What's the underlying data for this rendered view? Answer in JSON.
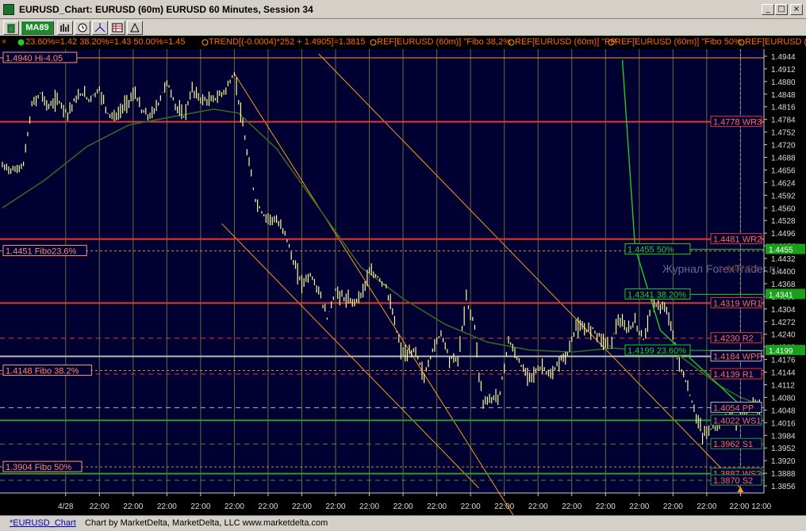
{
  "window": {
    "title": "EURUSD_Chart: EURUSD (60m) EURUSD 60 Minutes, Session 34",
    "minimize_label": "_",
    "maximize_label": "□",
    "close_label": "×"
  },
  "toolbar": {
    "ma_label": "MA89"
  },
  "indicator_bar": [
    "23.60%=1.42 38.20%=1.43 50.00%=1.45",
    "TREND[(-0.0004)*252 + 1.4905]=1.3815",
    "REF[EURUSD (60m)] \"Fibo 38,2%",
    "REF[EURUSD (60m)] \"PP",
    "REF[EURUSD (60m)] \"Fibo 50%",
    "REF[EURUSD ("
  ],
  "watermark": "Журнал ForexTrader.ru",
  "status": {
    "tab": "*EURUSD_Chart",
    "credit": "Chart by MarketDelta, MarketDelta, LLC www.marketdelta.com"
  },
  "colors": {
    "background": "#000033",
    "candles": "#ffff99",
    "resistance": "#e23a2a",
    "support": "#2f9a2f",
    "pivot": "#b8b8b8",
    "channel": "#ff9a1a",
    "moving_average": "#2f6a1f",
    "fibo_line": "#22cc22"
  },
  "chart_data": {
    "type": "line",
    "series": [
      {
        "name": "EURUSD",
        "x_index": [
          0,
          6,
          10,
          14,
          18,
          22,
          26,
          31,
          34,
          38,
          41,
          46,
          50,
          54,
          58,
          63,
          66,
          70,
          74,
          78,
          82,
          86,
          90,
          94,
          98,
          102,
          106,
          110,
          113,
          116,
          120,
          124,
          129,
          134,
          138,
          142,
          146,
          150,
          154,
          158,
          162,
          166,
          170,
          174,
          178,
          182,
          186,
          189,
          192,
          196,
          200,
          204,
          208,
          212,
          216,
          220,
          224,
          226,
          228,
          232,
          236,
          238,
          240,
          244,
          248,
          252,
          256,
          260,
          264,
          268,
          272,
          276,
          280,
          284,
          288,
          292,
          296,
          300,
          304,
          308,
          312,
          316,
          320,
          324,
          328,
          332,
          336,
          340,
          344,
          348,
          352,
          356,
          360
        ],
        "values": [
          1.4665,
          1.4655,
          1.467,
          1.482,
          1.485,
          1.4815,
          1.4835,
          1.48,
          1.483,
          1.485,
          1.4835,
          1.486,
          1.48,
          1.479,
          1.482,
          1.485,
          1.4805,
          1.479,
          1.4825,
          1.488,
          1.482,
          1.479,
          1.486,
          1.4835,
          1.483,
          1.484,
          1.486,
          1.49,
          1.48,
          1.47,
          1.458,
          1.454,
          1.453,
          1.45,
          1.442,
          1.437,
          1.439,
          1.435,
          1.428,
          1.435,
          1.433,
          1.432,
          1.434,
          1.4395,
          1.4385,
          1.436,
          1.427,
          1.42,
          1.4185,
          1.42,
          1.413,
          1.42,
          1.4245,
          1.418,
          1.4175,
          1.433,
          1.426,
          1.414,
          1.407,
          1.4075,
          1.409,
          1.416,
          1.4225,
          1.418,
          1.414,
          1.414,
          1.416,
          1.413,
          1.417,
          1.419,
          1.426,
          1.425,
          1.4255,
          1.423,
          1.421,
          1.4275,
          1.425,
          1.427,
          1.4225,
          1.432,
          1.431,
          1.429,
          1.418,
          1.412,
          1.405,
          1.3985,
          1.4,
          1.401,
          1.4035,
          1.402,
          1.404,
          1.406,
          1.405
        ]
      },
      {
        "name": "MA89",
        "x_index": [
          0,
          20,
          40,
          60,
          80,
          100,
          112,
          130,
          150,
          170,
          190,
          210,
          230,
          250,
          270,
          290,
          300,
          310,
          320,
          330,
          340,
          350,
          360
        ],
        "values": [
          1.456,
          1.463,
          1.4715,
          1.477,
          1.479,
          1.481,
          1.48,
          1.471,
          1.456,
          1.441,
          1.433,
          1.4265,
          1.422,
          1.42,
          1.4195,
          1.4205,
          1.42,
          1.421,
          1.419,
          1.415,
          1.411,
          1.408,
          1.406
        ]
      }
    ],
    "levels": [
      {
        "label": "1.4778 WR3",
        "value": 1.4778,
        "kind": "resistance",
        "style": "solid"
      },
      {
        "label": "1.4481 WR2",
        "value": 1.4481,
        "kind": "resistance",
        "style": "solid"
      },
      {
        "label": "1.4319 WR1",
        "value": 1.4319,
        "kind": "resistance",
        "style": "solid"
      },
      {
        "label": "1.4230 R2",
        "value": 1.423,
        "kind": "resistance",
        "style": "dashed"
      },
      {
        "label": "1.4184 WPP",
        "value": 1.4184,
        "kind": "pivot",
        "style": "solid"
      },
      {
        "label": "1.4139 R1",
        "value": 1.4139,
        "kind": "resistance",
        "style": "dashed"
      },
      {
        "label": "1.4054 PP",
        "value": 1.4054,
        "kind": "pivot",
        "style": "dashed"
      },
      {
        "label": "1.4022 WS1",
        "value": 1.4022,
        "kind": "support",
        "style": "solid"
      },
      {
        "label": "1.3962 S1",
        "value": 1.3962,
        "kind": "support",
        "style": "dashed"
      },
      {
        "label": "1.3887 WS2",
        "value": 1.3887,
        "kind": "support",
        "style": "solid"
      },
      {
        "label": "1.3870 S2",
        "value": 1.387,
        "kind": "support",
        "style": "dashed"
      }
    ],
    "left_labels": [
      {
        "label": "1.4940 Hi-4.05",
        "value": 1.494
      },
      {
        "label": "1.4451 Fibo23.6%",
        "value": 1.4451
      },
      {
        "label": "1.4148 Fibo 38.2%",
        "value": 1.4148
      },
      {
        "label": "1.3904 Fibo 50%",
        "value": 1.3904
      }
    ],
    "fibo_labels": [
      {
        "label": "1.4455 50%",
        "value": 1.4455
      },
      {
        "label": "1.4341 38.20%",
        "value": 1.4341
      },
      {
        "label": "1.4199 23.60%",
        "value": 1.4199
      }
    ],
    "faded_label": {
      "label": "1.4407 R3",
      "value": 1.4407
    },
    "price_tags": [
      {
        "label": "1.4455",
        "value": 1.4455
      },
      {
        "label": "1.4341",
        "value": 1.4341
      },
      {
        "label": "1.4199",
        "value": 1.4199
      }
    ],
    "y_ticks": [
      1.4944,
      1.4912,
      1.488,
      1.4848,
      1.4816,
      1.4784,
      1.4752,
      1.472,
      1.4688,
      1.4656,
      1.4624,
      1.4592,
      1.456,
      1.4528,
      1.4496,
      1.4464,
      1.4432,
      1.44,
      1.4368,
      1.4336,
      1.4304,
      1.4272,
      1.424,
      1.4208,
      1.4176,
      1.4144,
      1.4112,
      1.408,
      1.4048,
      1.4016,
      1.3984,
      1.3952,
      1.392,
      1.3888,
      1.3856
    ],
    "x_tick_labels": [
      "4/28",
      "22:00",
      "22:00",
      "22:00",
      "22:00",
      "22:00",
      "22:00",
      "22:00",
      "22:00",
      "22:00",
      "22:00",
      "22:00",
      "22:00",
      "22:00",
      "22:00",
      "22:00",
      "22:00",
      "22:00",
      "22:00",
      "22:00",
      "22:00 12:00"
    ],
    "x_tick_index": [
      30,
      46,
      62,
      78,
      94,
      110,
      126,
      142,
      158,
      174,
      190,
      206,
      222,
      238,
      254,
      270,
      286,
      302,
      318,
      334,
      350
    ],
    "channels": [
      {
        "x_index": [
          110,
          246
        ],
        "values": [
          1.49,
          1.375
        ]
      },
      {
        "x_index": [
          104,
          226
        ],
        "values": [
          1.452,
          1.385
        ]
      },
      {
        "x_index": [
          150,
          350
        ],
        "values": [
          1.495,
          1.385
        ]
      }
    ],
    "fibo_swing": {
      "x_index": [
        294,
        300,
        312,
        350
      ],
      "values": [
        1.4935,
        1.446,
        1.425,
        1.406
      ]
    },
    "ylim": [
      1.3838,
      1.4962
    ],
    "grid": true
  }
}
